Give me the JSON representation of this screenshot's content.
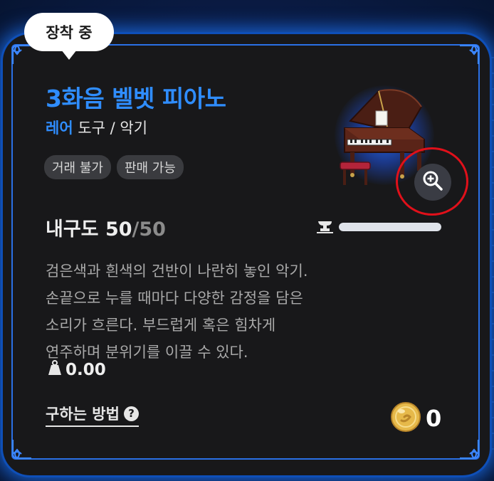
{
  "badge": {
    "label": "장착 중"
  },
  "item": {
    "name": "3화음 벨벳 피아노",
    "rarity": "레어",
    "category": "도구 / 악기",
    "tags": [
      "거래 불가",
      "판매 가능"
    ],
    "durability_label": "내구도",
    "durability_current": "50",
    "durability_max": "/50",
    "durability_fraction": 1.0,
    "description_lines": [
      "검은색과 흰색의 건반이 나란히 놓인 악기.",
      "손끝으로 누를 때마다 다양한 감정을 담은",
      "소리가 흐른다. 부드럽게 혹은 힘차게",
      "연주하며 분위기를 이끌 수 있다."
    ],
    "weight": "0.00"
  },
  "footer": {
    "howto_label": "구하는 방법",
    "help_symbol": "?",
    "coin_count": "0"
  },
  "icons": {
    "zoom": "zoom-in-icon",
    "anvil": "anvil-icon",
    "weight": "weight-icon",
    "help": "help-icon",
    "coin": "gold-coin-icon"
  },
  "colors": {
    "accent": "#2f8dff",
    "card_bg": "#18181a",
    "highlight_ring": "#e0101a",
    "coin": "#e6b94a"
  }
}
